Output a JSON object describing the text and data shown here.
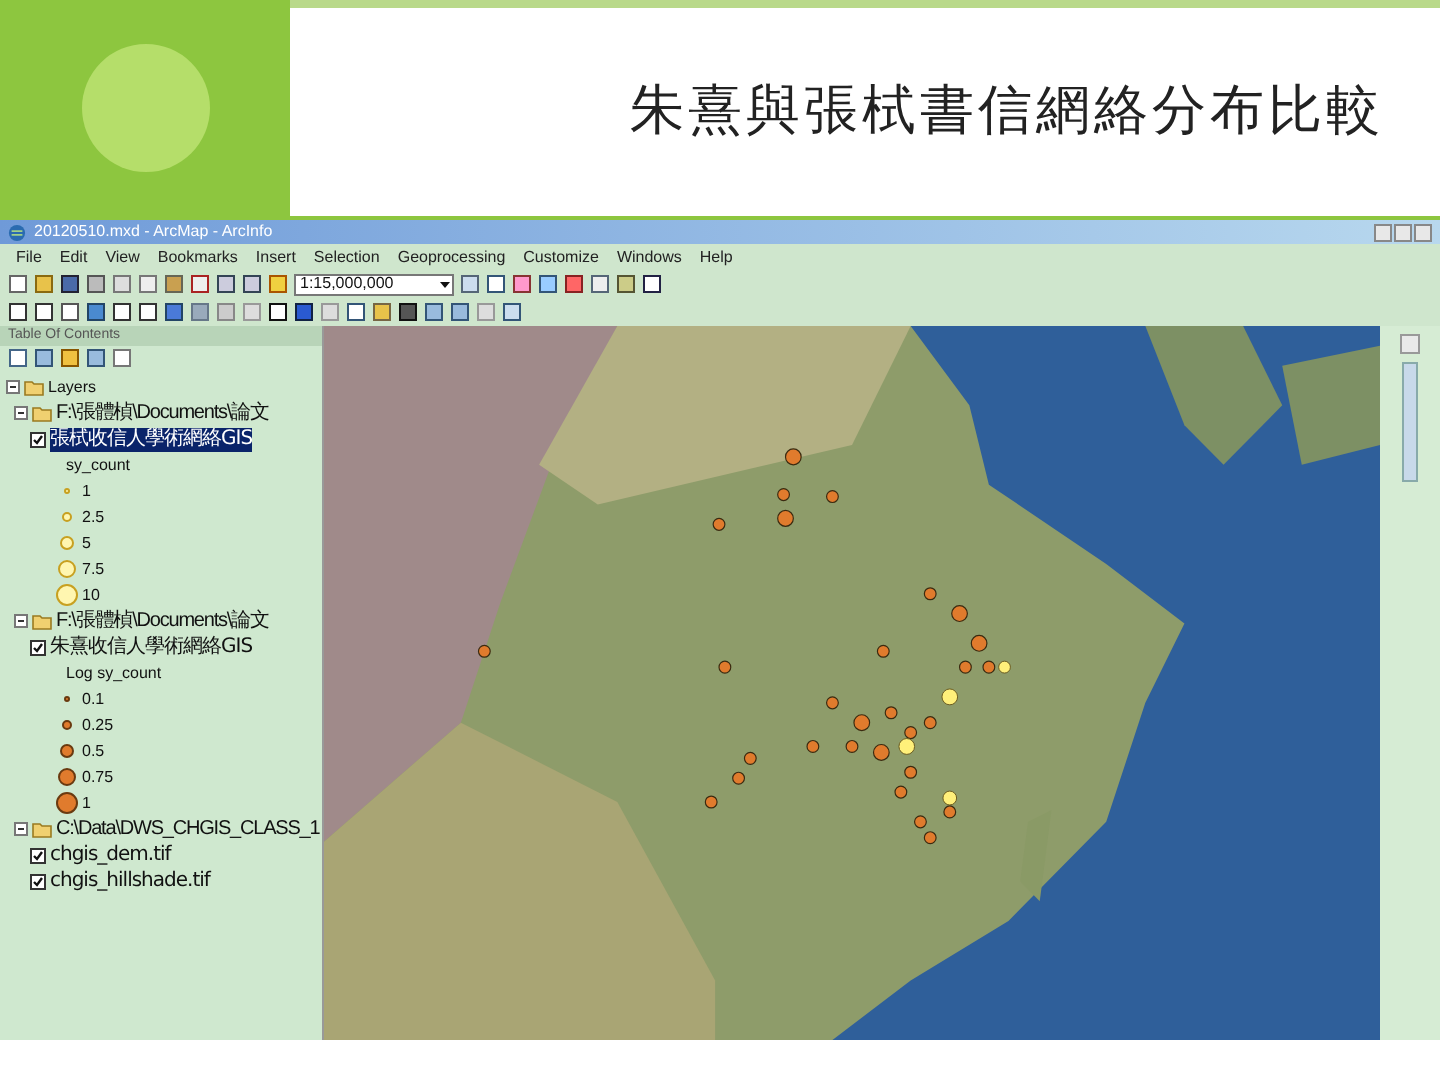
{
  "slide": {
    "title": "朱熹與張栻書信網絡分布比較"
  },
  "window": {
    "title": "20120510.mxd - ArcMap - ArcInfo"
  },
  "menu": [
    "File",
    "Edit",
    "View",
    "Bookmarks",
    "Insert",
    "Selection",
    "Geoprocessing",
    "Customize",
    "Windows",
    "Help"
  ],
  "toolbar": {
    "scale": "1:15,000,000"
  },
  "toc": {
    "title": "Table Of Contents",
    "root": {
      "label": "Layers",
      "expanded": true,
      "children": [
        {
          "label": "F:\\張體楨\\Documents\\論文",
          "expanded": true,
          "children": [
            {
              "label": "張栻收信人學術網絡GIS",
              "checked": true,
              "selected": true,
              "kind": "hollow",
              "legend_title": "sy_count",
              "legend": [
                "1",
                "2.5",
                "5",
                "7.5",
                "10"
              ]
            }
          ]
        },
        {
          "label": "F:\\張體楨\\Documents\\論文",
          "expanded": true,
          "children": [
            {
              "label": "朱熹收信人學術網絡GIS",
              "checked": true,
              "selected": false,
              "kind": "filled",
              "legend_title": "Log sy_count",
              "legend": [
                "0.1",
                "0.25",
                "0.5",
                "0.75",
                "1"
              ]
            }
          ]
        },
        {
          "label": "C:\\Data\\DWS_CHGIS_CLASS_1",
          "expanded": true,
          "children": [
            {
              "label": "chgis_dem.tif",
              "checked": true,
              "selected": false
            },
            {
              "label": "chgis_hillshade.tif",
              "checked": true,
              "selected": false
            }
          ]
        }
      ]
    }
  }
}
